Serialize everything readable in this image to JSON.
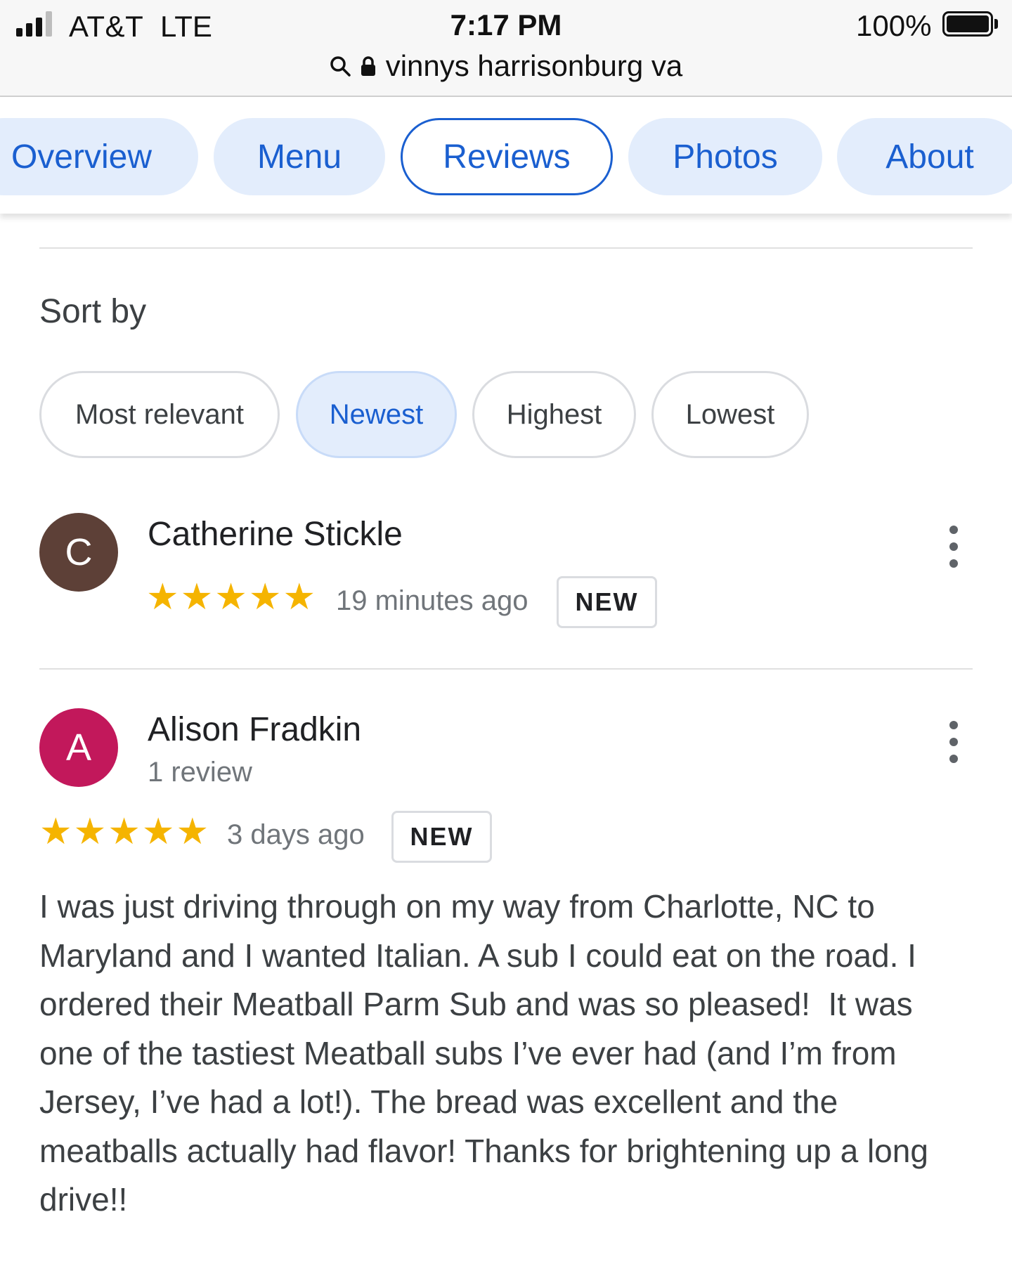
{
  "status_bar": {
    "carrier": "AT&T",
    "network": "LTE",
    "time": "7:17 PM",
    "battery": "100%"
  },
  "address_bar": {
    "query": "vinnys harrisonburg va"
  },
  "tabs": [
    {
      "label": "Overview",
      "active": false
    },
    {
      "label": "Menu",
      "active": false
    },
    {
      "label": "Reviews",
      "active": true
    },
    {
      "label": "Photos",
      "active": false
    },
    {
      "label": "About",
      "active": false
    }
  ],
  "sort": {
    "label": "Sort by",
    "options": [
      {
        "label": "Most relevant",
        "selected": false
      },
      {
        "label": "Newest",
        "selected": true
      },
      {
        "label": "Highest",
        "selected": false
      },
      {
        "label": "Lowest",
        "selected": false
      }
    ]
  },
  "reviews": [
    {
      "initial": "C",
      "avatar_color": "#5d4037",
      "name": "Catherine Stickle",
      "review_count": "",
      "rating": 5,
      "time": "19 minutes ago",
      "badge": "NEW",
      "text": ""
    },
    {
      "initial": "A",
      "avatar_color": "#c2185b",
      "name": "Alison Fradkin",
      "review_count": "1 review",
      "rating": 5,
      "time": "3 days ago",
      "badge": "NEW",
      "text": "I was just driving through on my way from Charlotte, NC to Maryland and I wanted Italian. A sub I could eat on the road. I ordered their Meatball Parm Sub and was so pleased!  It was one of the tastiest Meatball subs I’ve ever had (and I’m from Jersey, I’ve had a lot!). The bread was excellent and the meatballs actually had flavor! Thanks for brightening up a long drive!!"
    }
  ],
  "colors": {
    "accent": "#1a5fd0",
    "tab_bg": "#e3edfc",
    "star": "#f5b400"
  }
}
